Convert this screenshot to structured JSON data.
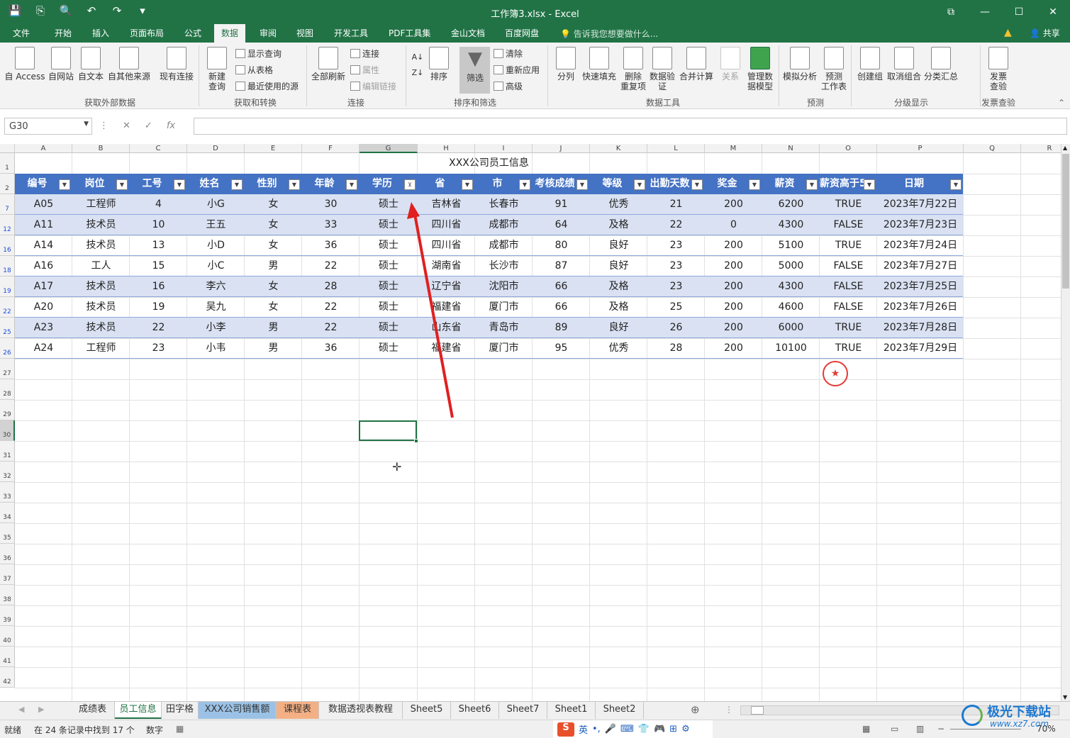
{
  "app": {
    "doc_title": "工作簿3.xlsx - Excel",
    "quick_access": [
      "💾",
      "⎘",
      "🔍",
      "↶",
      "↷",
      "▾"
    ],
    "window_controls": [
      "⧉",
      "—",
      "☐",
      "✕"
    ]
  },
  "menu_tabs": [
    "文件",
    "开始",
    "插入",
    "页面布局",
    "公式",
    "数据",
    "审阅",
    "视图",
    "开发工具",
    "PDF工具集",
    "金山文档",
    "百度网盘"
  ],
  "active_menu_tab": "数据",
  "tell_me": "告诉我您想要做什么...",
  "share_label": "共享",
  "ribbon": {
    "get_external": {
      "items": [
        "自 Access",
        "自网站",
        "自文本",
        "自其他来源",
        "现有连接"
      ],
      "label": "获取外部数据"
    },
    "transform": {
      "new_query": "新建\n查询",
      "small": [
        "显示查询",
        "从表格",
        "最近使用的源"
      ],
      "label": "获取和转换"
    },
    "connections": {
      "refresh_all": "全部刷新",
      "small": [
        "连接",
        "属性",
        "编辑链接"
      ],
      "label": "连接"
    },
    "sort_filter": {
      "sort": "排序",
      "filter": "筛选",
      "small": [
        "清除",
        "重新应用",
        "高级"
      ],
      "label": "排序和筛选"
    },
    "data_tools": {
      "items": [
        "分列",
        "快速填充",
        "删除\n重复项",
        "数据验\n证",
        "合并计算",
        "关系",
        "管理数\n据模型"
      ],
      "label": "数据工具"
    },
    "forecast": {
      "items": [
        "模拟分析",
        "预测\n工作表"
      ],
      "label": "预测"
    },
    "outline": {
      "items": [
        "创建组",
        "取消组合",
        "分类汇总"
      ],
      "label": "分级显示"
    },
    "invoice": {
      "items": [
        "发票\n查验"
      ],
      "label": "发票查验"
    }
  },
  "formula_bar": {
    "name_box": "G30",
    "formula": ""
  },
  "columns": [
    "A",
    "B",
    "C",
    "D",
    "E",
    "F",
    "G",
    "H",
    "I",
    "J",
    "K",
    "L",
    "M",
    "N",
    "O",
    "P",
    "Q",
    "R"
  ],
  "row_numbers": [
    "1",
    "2",
    "7",
    "12",
    "16",
    "18",
    "19",
    "22",
    "25",
    "26",
    "27",
    "28",
    "29",
    "30",
    "31",
    "32",
    "33",
    "34",
    "35",
    "36",
    "37",
    "38",
    "39",
    "40",
    "41",
    "42"
  ],
  "sheet": {
    "title": "XXX公司员工信息",
    "headers": [
      "编号",
      "岗位",
      "工号",
      "姓名",
      "性别",
      "年龄",
      "学历",
      "省",
      "市",
      "考核成绩",
      "等级",
      "出勤天数",
      "奖金",
      "薪资",
      "薪资高于5",
      "日期"
    ],
    "rows": [
      [
        "A05",
        "工程师",
        "4",
        "小G",
        "女",
        "30",
        "硕士",
        "吉林省",
        "长春市",
        "91",
        "优秀",
        "21",
        "200",
        "6200",
        "TRUE",
        "2023年7月22日"
      ],
      [
        "A11",
        "技术员",
        "10",
        "王五",
        "女",
        "33",
        "硕士",
        "四川省",
        "成都市",
        "64",
        "及格",
        "22",
        "0",
        "4300",
        "FALSE",
        "2023年7月23日"
      ],
      [
        "A14",
        "技术员",
        "13",
        "小D",
        "女",
        "36",
        "硕士",
        "四川省",
        "成都市",
        "80",
        "良好",
        "23",
        "200",
        "5100",
        "TRUE",
        "2023年7月24日"
      ],
      [
        "A16",
        "工人",
        "15",
        "小C",
        "男",
        "22",
        "硕士",
        "湖南省",
        "长沙市",
        "87",
        "良好",
        "23",
        "200",
        "5000",
        "FALSE",
        "2023年7月27日"
      ],
      [
        "A17",
        "技术员",
        "16",
        "李六",
        "女",
        "28",
        "硕士",
        "辽宁省",
        "沈阳市",
        "66",
        "及格",
        "23",
        "200",
        "4300",
        "FALSE",
        "2023年7月25日"
      ],
      [
        "A20",
        "技术员",
        "19",
        "吴九",
        "女",
        "22",
        "硕士",
        "福建省",
        "厦门市",
        "66",
        "及格",
        "25",
        "200",
        "4600",
        "FALSE",
        "2023年7月26日"
      ],
      [
        "A23",
        "技术员",
        "22",
        "小李",
        "男",
        "22",
        "硕士",
        "山东省",
        "青岛市",
        "89",
        "良好",
        "26",
        "200",
        "6000",
        "TRUE",
        "2023年7月28日"
      ],
      [
        "A24",
        "工程师",
        "23",
        "小韦",
        "男",
        "36",
        "硕士",
        "福建省",
        "厦门市",
        "95",
        "优秀",
        "28",
        "200",
        "10100",
        "TRUE",
        "2023年7月29日"
      ]
    ]
  },
  "sheet_tabs": [
    "成绩表",
    "员工信息",
    "田字格",
    "XXX公司销售额",
    "课程表",
    "数据透视表教程",
    "Sheet5",
    "Sheet6",
    "Sheet7",
    "Sheet1",
    "Sheet2"
  ],
  "active_sheet": "员工信息",
  "status": {
    "ready": "就绪",
    "filter_msg": "在 24 条记录中找到 17 个",
    "mode": "数字",
    "ime": [
      "S",
      "英",
      "•,",
      "🎤",
      "⌨",
      "👕",
      "🎮",
      "⊞",
      "⚙"
    ],
    "zoom": "70%"
  },
  "watermark": {
    "name": "极光下载站",
    "url": "www.xz7.com"
  },
  "colors": {
    "excel_green": "#217346",
    "table_header": "#4472c4",
    "table_band": "#d9e1f2",
    "annotation_arrow": "#e02020"
  }
}
